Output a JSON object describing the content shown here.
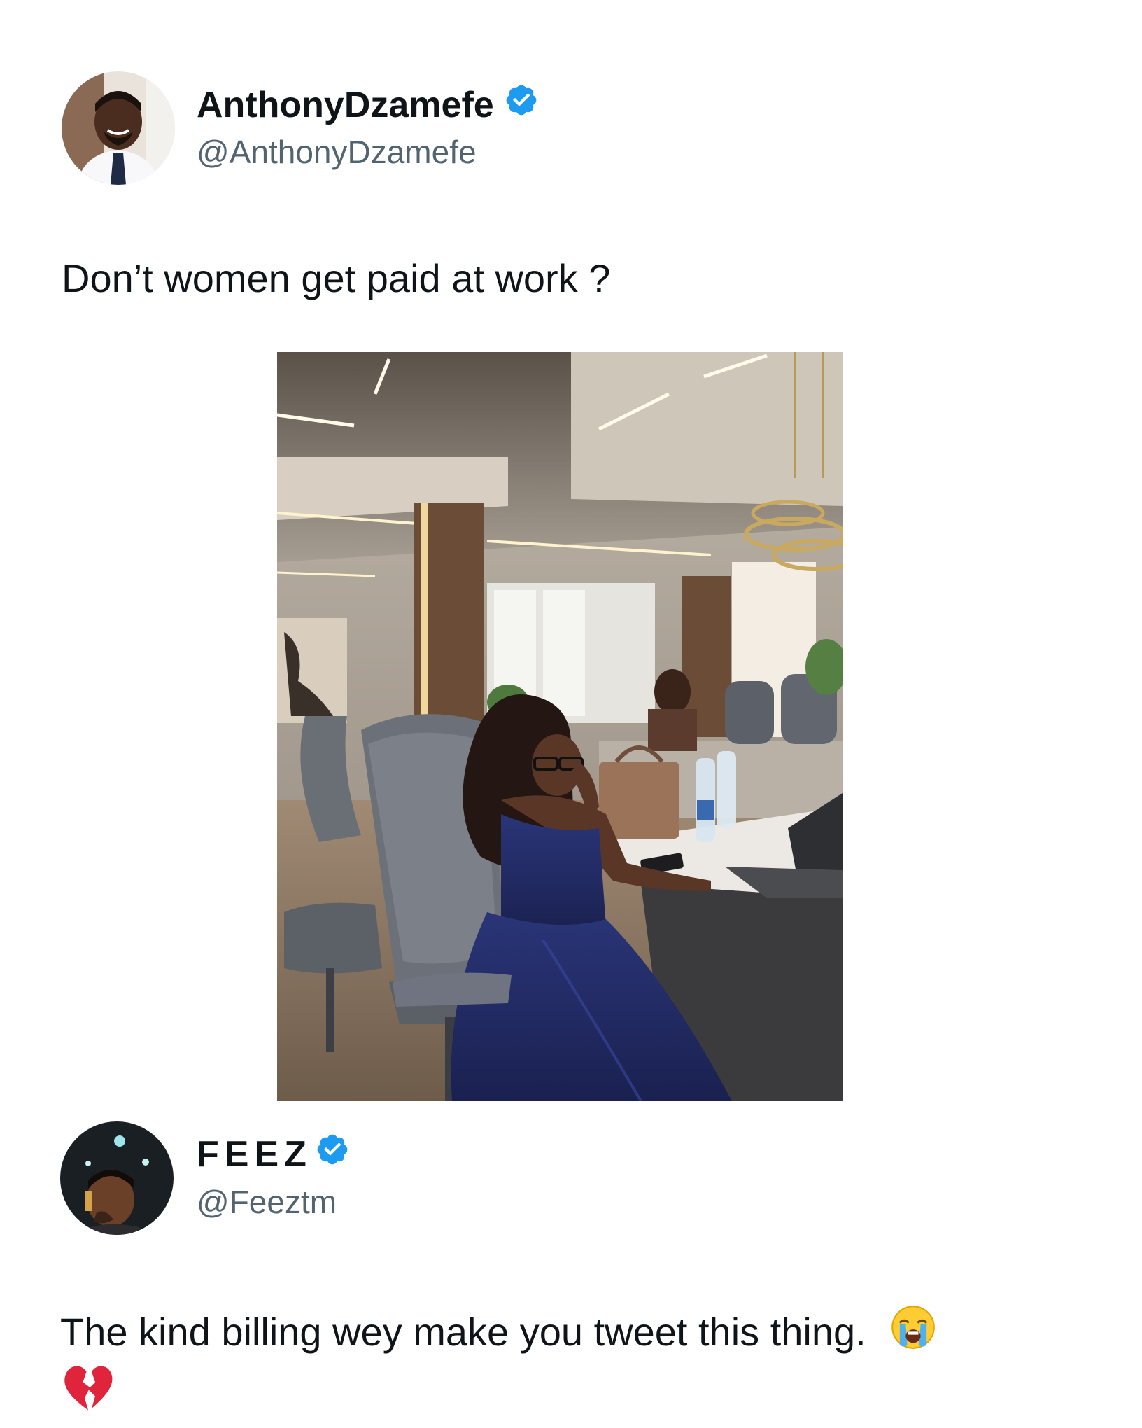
{
  "tweet1": {
    "display_name": "AnthonyDzamefe",
    "handle": "@AnthonyDzamefe",
    "verified": true,
    "text": "Don’t women get paid at work ?",
    "avatar_icon": "user-avatar-man-suit",
    "media_icon": "photo-woman-blue-gown-office"
  },
  "tweet2": {
    "display_name": "FEEZ",
    "handle": "@Feeztm",
    "verified": true,
    "text": "The kind billing wey make you tweet this thing.",
    "avatar_icon": "user-avatar-man-dark",
    "emoji_crying": "loudly-crying-face-emoji",
    "emoji_heart": "broken-heart-emoji"
  },
  "colors": {
    "verified_blue": "#1d9bf0",
    "text_primary": "#0f1419",
    "text_secondary": "#536471"
  }
}
